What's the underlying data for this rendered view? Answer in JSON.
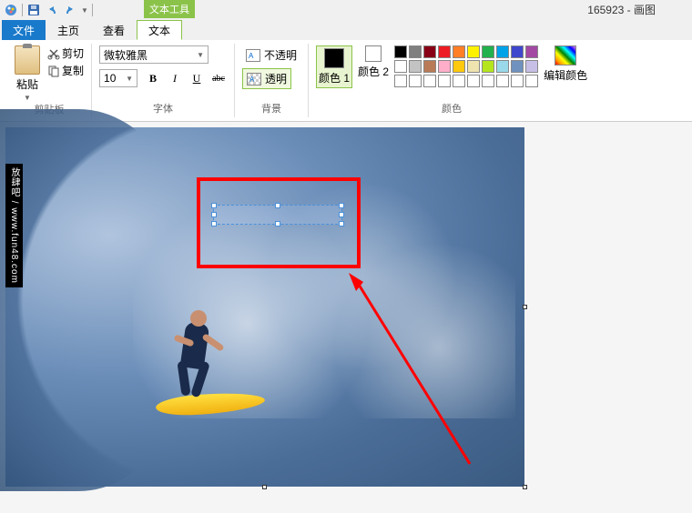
{
  "title": "165923 - 画图",
  "context_tab_label": "文本工具",
  "tabs": {
    "file": "文件",
    "home": "主页",
    "view": "查看",
    "text": "文本"
  },
  "clipboard": {
    "paste": "粘贴",
    "cut": "剪切",
    "copy": "复制",
    "group": "剪贴板"
  },
  "font": {
    "name": "微软雅黑",
    "size": "10",
    "bold": "B",
    "italic": "I",
    "underline": "U",
    "strike": "abc",
    "group": "字体"
  },
  "bg": {
    "opaque": "不透明",
    "transparent": "透明",
    "group": "背景"
  },
  "colors": {
    "color1": "颜色 1",
    "color2": "颜色 2",
    "edit": "编辑颜色",
    "group": "颜色",
    "c1_hex": "#000000",
    "c2_hex": "#ffffff",
    "palette": [
      [
        "#000000",
        "#7f7f7f",
        "#880015",
        "#ed1c24",
        "#ff7f27",
        "#fff200",
        "#22b14c",
        "#00a2e8",
        "#3f48cc",
        "#a349a4"
      ],
      [
        "#ffffff",
        "#c3c3c3",
        "#b97a57",
        "#ffaec9",
        "#ffc90e",
        "#efe4b0",
        "#b5e61d",
        "#99d9ea",
        "#7092be",
        "#c8bfe7"
      ],
      [
        "#ffffff",
        "#ffffff",
        "#ffffff",
        "#ffffff",
        "#ffffff",
        "#ffffff",
        "#ffffff",
        "#ffffff",
        "#ffffff",
        "#ffffff"
      ]
    ]
  },
  "watermark": "放肆吧 / www.fun48.com"
}
